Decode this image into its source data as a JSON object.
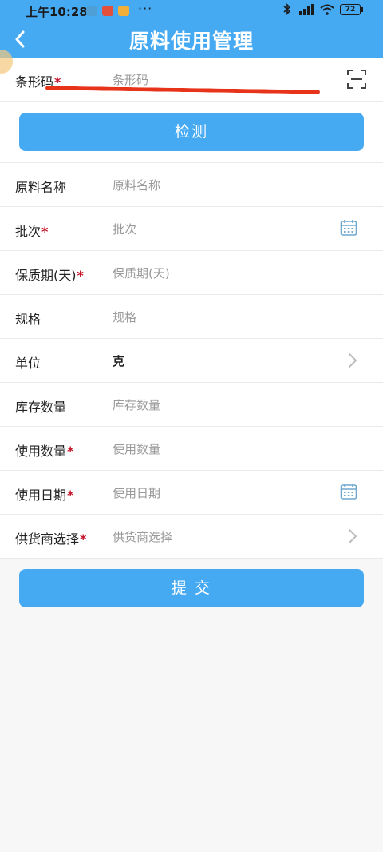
{
  "status": {
    "time": "上午10:28",
    "more": "···",
    "battery": "72"
  },
  "header": {
    "title": "原料使用管理"
  },
  "barcode": {
    "label": "条形码",
    "required": "*",
    "placeholder": "条形码"
  },
  "detect_button": "检测",
  "fields": [
    {
      "label": "原料名称",
      "required": "",
      "value": "原料名称"
    },
    {
      "label": "批次",
      "required": "*",
      "value": "批次"
    },
    {
      "label": "保质期(天)",
      "required": "*",
      "value": "保质期(天)"
    },
    {
      "label": "规格",
      "required": "",
      "value": "规格"
    },
    {
      "label": "单位",
      "required": "",
      "value": "克"
    },
    {
      "label": "库存数量",
      "required": "",
      "value": "库存数量"
    },
    {
      "label": "使用数量",
      "required": "*",
      "value": "使用数量"
    },
    {
      "label": "使用日期",
      "required": "*",
      "value": "使用日期"
    },
    {
      "label": "供货商选择",
      "required": "*",
      "value": "供货商选择"
    }
  ],
  "submit_button": "提 交",
  "colors": {
    "primary": "#46aaf3",
    "required": "#c4142a",
    "redaction": "#e8331b"
  }
}
